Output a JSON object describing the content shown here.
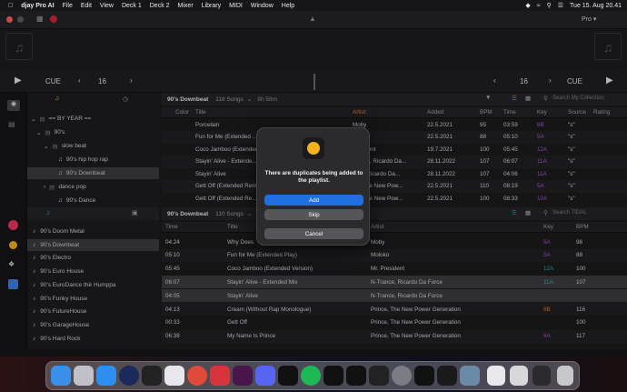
{
  "menubar": {
    "app": "djay Pro AI",
    "items": [
      "File",
      "Edit",
      "View",
      "Deck 1",
      "Deck 2",
      "Mixer",
      "Library",
      "MIDI",
      "Window",
      "Help"
    ],
    "clock": "Tue 15. Aug  20.41"
  },
  "toolbar": {
    "pro_label": "Pro"
  },
  "transport": {
    "cue_left": "CUE",
    "cue_right": "CUE",
    "pitch_left": "16",
    "pitch_right": "16"
  },
  "library": {
    "upper_title": "90's Downbeat",
    "upper_count": "118 Songs",
    "upper_duration": "8h 58m",
    "search_placeholder": "Search My Collection",
    "columns": {
      "color": "Color",
      "title": "Title",
      "artist": "Artist",
      "added": "Added",
      "bpm": "BPM",
      "time": "Time",
      "key": "Key",
      "source": "Source",
      "rating": "Rating"
    },
    "tree": [
      {
        "label": "== BY YEAR =="
      },
      {
        "label": "90's"
      },
      {
        "label": "slow beat"
      },
      {
        "label": "90's hip hop rap"
      },
      {
        "label": "90's Downbeat"
      },
      {
        "label": "dance pop"
      },
      {
        "label": "90's Dance"
      }
    ],
    "upper_rows": [
      {
        "title": "Porcelain",
        "artist": "Moby",
        "added": "22.5.2021",
        "bpm": "95",
        "time": "03:59",
        "key": "6B",
        "source": "\"s\""
      },
      {
        "title": "Fun for Me (Extended ...",
        "artist": "...o",
        "added": "22.5.2021",
        "bpm": "88",
        "time": "05:10",
        "key": "5A",
        "source": "\"s\""
      },
      {
        "title": "Coco Jamboo (Extended ...",
        "artist": "...esident",
        "added": "19.7.2021",
        "bpm": "100",
        "time": "05:45",
        "key": "12A",
        "source": "\"s\""
      },
      {
        "title": "Stayin' Alive - Extende...",
        "artist": "...ance, Ricardo Da...",
        "added": "28.11.2022",
        "bpm": "107",
        "time": "06:07",
        "key": "11A",
        "source": "\"s\""
      },
      {
        "title": "Stayin' Alive",
        "artist": "...ce, Ricardo Da...",
        "added": "28.11.2022",
        "bpm": "107",
        "time": "04:06",
        "key": "11A",
        "source": "\"s\""
      },
      {
        "title": "Gett Off (Extended Rem...",
        "artist": "...& The New Pow...",
        "added": "22.5.2021",
        "bpm": "110",
        "time": "08:19",
        "key": "5A",
        "source": "\"s\""
      },
      {
        "title": "Gett Off (Extended Re...",
        "artist": "...& The New Pow...",
        "added": "22.5.2021",
        "bpm": "100",
        "time": "08:33",
        "key": "10A",
        "source": "\"s\""
      }
    ],
    "lower_title": "90's Downbeat",
    "lower_count": "110 Songs",
    "lower_search_placeholder": "Search TIDAL",
    "lower_columns": {
      "time": "Time",
      "title": "Title",
      "artist": "Artist",
      "key": "Key",
      "bpm": "BPM"
    },
    "playlists": [
      "90's Doom Metal",
      "90's Downbeat",
      "90's Electro",
      "90's Euro House",
      "90's EuroDance thë Humppa",
      "90's Funky House",
      "90's FutureHouse",
      "90's GarageHouse",
      "90's Hard Rock"
    ],
    "lower_rows": [
      {
        "time": "04:24",
        "title": "Why Does",
        "artist": "Moby",
        "key": "6A",
        "bpm": "98"
      },
      {
        "time": "05:10",
        "title": "Fun for Me (Extended Play)",
        "artist": "Moloko",
        "key": "5A",
        "bpm": "88"
      },
      {
        "time": "05:45",
        "title": "Coco Jamboo (Extended Version)",
        "artist": "Mr. President",
        "key": "12A",
        "bpm": "100"
      },
      {
        "time": "06:07",
        "title": "Stayin' Alive - Extended Mix",
        "artist": "N-Trance, Ricardo Da Force",
        "key": "11A",
        "bpm": "107"
      },
      {
        "time": "04:05",
        "title": "Stayin' Alive",
        "artist": "N-Trance, Ricardo Da Force",
        "key": "",
        "bpm": ""
      },
      {
        "time": "04:13",
        "title": "Cream (Without Rap Monologue)",
        "artist": "Prince, The New Power Generation",
        "key": "6B",
        "bpm": "116"
      },
      {
        "time": "00:33",
        "title": "Gett Off",
        "artist": "Prince, The New Power Generation",
        "key": "",
        "bpm": "100"
      },
      {
        "time": "06:38",
        "title": "My Name Is Prince",
        "artist": "Prince, The New Power Generation",
        "key": "6A",
        "bpm": "117"
      }
    ]
  },
  "dialog": {
    "message": "There are duplicates being added to the playlist.",
    "add": "Add",
    "skip": "Skip",
    "cancel": "Cancel"
  },
  "colors": {
    "accent": "#1f6fe0",
    "key_teal": "#2aa3b5",
    "key_orange": "#d9742b",
    "key_purple": "#a24fc8"
  }
}
